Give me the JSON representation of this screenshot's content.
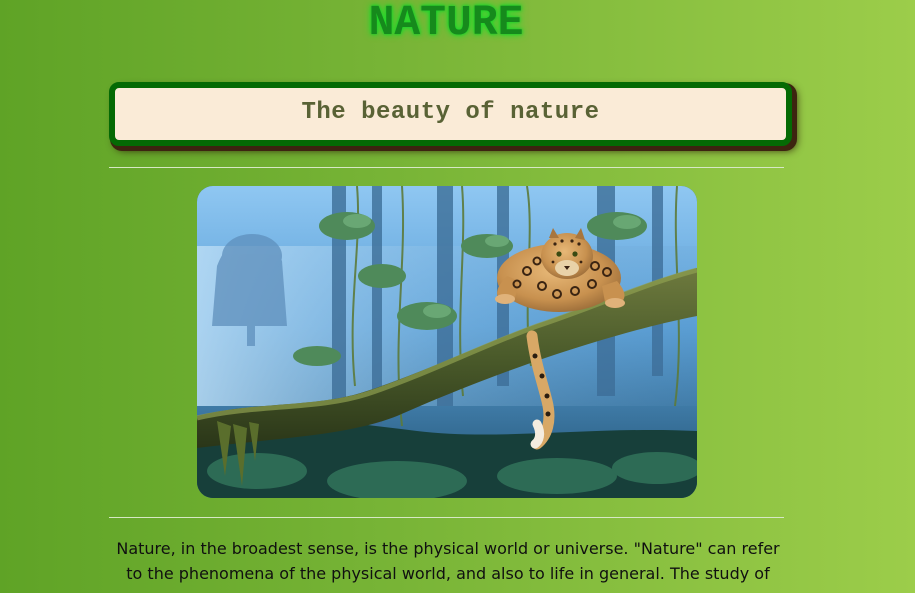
{
  "page": {
    "title": "NATURE",
    "banner_text": "The beauty of nature",
    "intro": "Nature, in the broadest sense, is the physical world or universe. \"Nature\" can refer to the phenomena of the physical world, and also to life in general. The study of"
  },
  "image": {
    "subject": "leopard-on-jungle-branch"
  },
  "colors": {
    "title": "#168a1c",
    "title_glow": "#22e02e",
    "banner_bg": "#faebd7",
    "banner_border": "#046a04",
    "banner_text": "#596235",
    "body_text": "#101010",
    "page_gradient_left": "#5fa326",
    "page_gradient_right": "#9ccd4a"
  }
}
